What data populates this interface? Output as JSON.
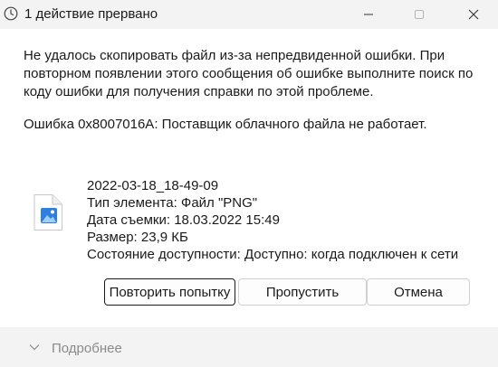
{
  "window": {
    "title": "1 действие прервано",
    "minimize_icon": "minimize-icon",
    "maximize_icon": "maximize-icon",
    "close_icon": "close-icon"
  },
  "message": {
    "text": "Не удалось скопировать файл из-за непредвиденной ошибки. При повторном появлении этого сообщения об ошибке выполните поиск по коду ошибки для получения справки по этой проблеме.",
    "error": "Ошибка 0x8007016A: Поставщик облачного файла не работает."
  },
  "file": {
    "icon": "image-file-icon",
    "name": "2022-03-18_18-49-09",
    "type": "Тип элемента: Файл \"PNG\"",
    "date": "Дата съемки: 18.03.2022 15:49",
    "size": "Размер: 23,9 КБ",
    "availability": "Состояние доступности: Доступно: когда подключен к сети"
  },
  "buttons": {
    "retry": "Повторить попытку",
    "skip": "Пропустить",
    "cancel": "Отмена"
  },
  "footer": {
    "details_label": "Подробнее",
    "chevron_icon": "chevron-down-icon"
  },
  "colors": {
    "titlebar_bg": "#f3f3f3",
    "content_bg": "#ffffff",
    "footer_bg": "#f3f3f3",
    "muted_text": "#8a8a8a"
  }
}
